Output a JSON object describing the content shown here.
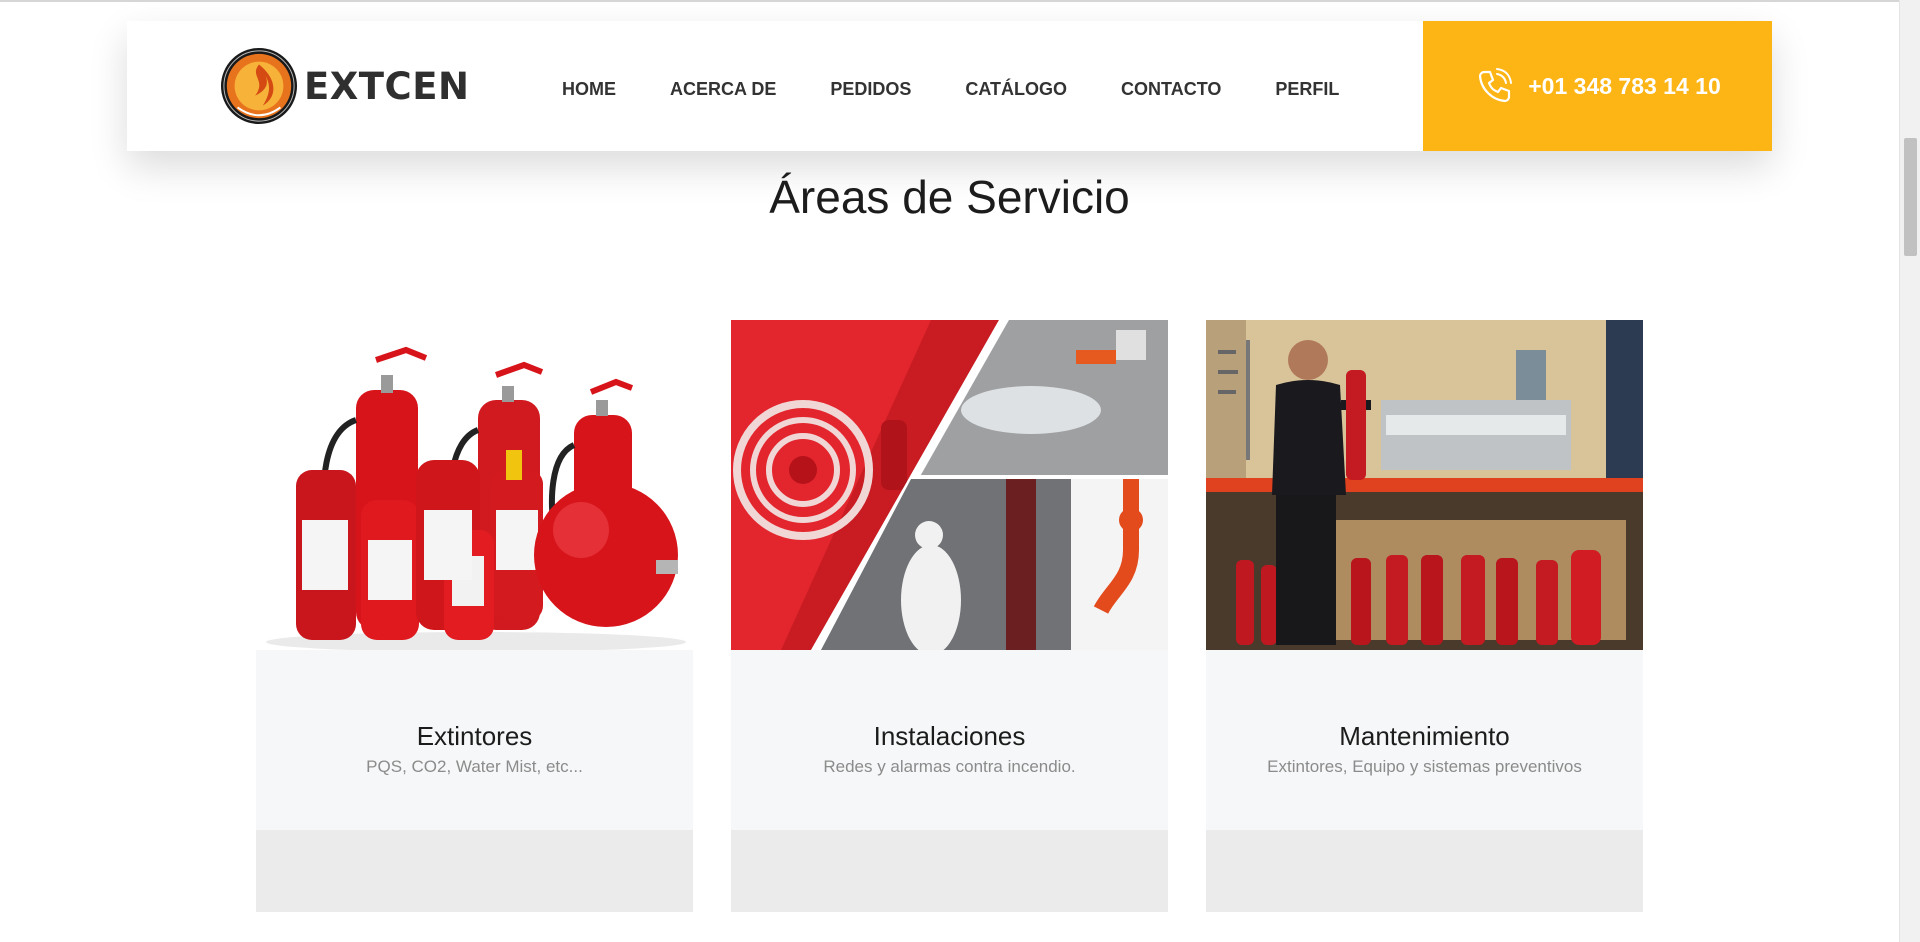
{
  "header": {
    "brand": "EXTCEN",
    "nav": [
      "HOME",
      "ACERCA DE",
      "PEDIDOS",
      "CATÁLOGO",
      "CONTACTO",
      "PERFIL"
    ],
    "phone": "+01 348 783 14 10",
    "phone_icon": "phone-icon",
    "accent_color": "#fdb515"
  },
  "section": {
    "title": "Áreas de Servicio"
  },
  "cards": [
    {
      "title": "Extintores",
      "subtitle": "PQS, CO2, Water Mist, etc..."
    },
    {
      "title": "Instalaciones",
      "subtitle": "Redes y alarmas contra incendio."
    },
    {
      "title": "Mantenimiento",
      "subtitle": "Extintores, Equipo y sistemas preventivos"
    }
  ]
}
